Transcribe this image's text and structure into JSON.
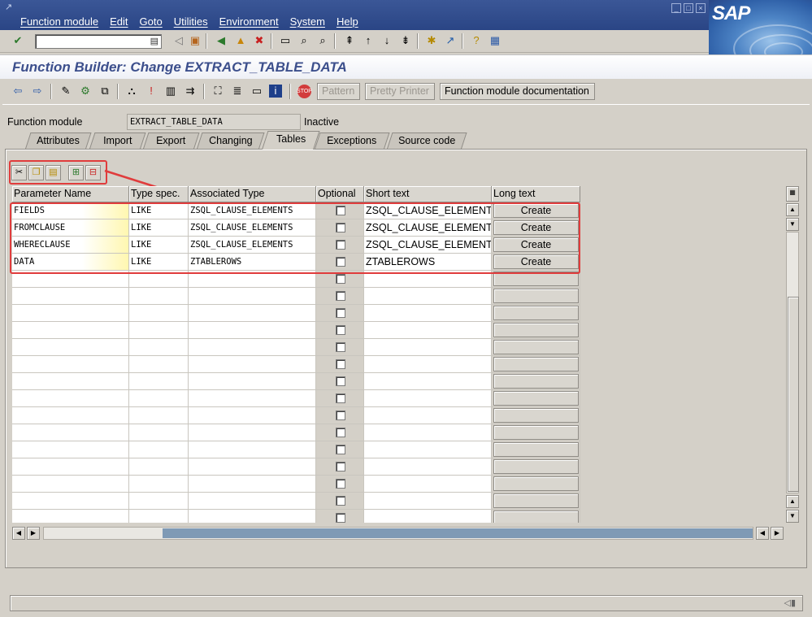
{
  "menu": [
    "Function module",
    "Edit",
    "Goto",
    "Utilities",
    "Environment",
    "System",
    "Help"
  ],
  "brand": {
    "logo_text": "SAP"
  },
  "command_field": {
    "value": ""
  },
  "title": "Function Builder: Change EXTRACT_TABLE_DATA",
  "app_toolbar": {
    "pattern_label": "Pattern",
    "pretty_printer_label": "Pretty Printer",
    "fm_doc_label": "Function module documentation"
  },
  "header_fields": {
    "function_module_label": "Function module",
    "function_module_value": "EXTRACT_TABLE_DATA",
    "status": "Inactive"
  },
  "tabs": [
    {
      "label": "Attributes",
      "active": false
    },
    {
      "label": "Import",
      "active": false
    },
    {
      "label": "Export",
      "active": false
    },
    {
      "label": "Changing",
      "active": false
    },
    {
      "label": "Tables",
      "active": true
    },
    {
      "label": "Exceptions",
      "active": false
    },
    {
      "label": "Source code",
      "active": false
    }
  ],
  "table": {
    "columns": [
      "Parameter Name",
      "Type spec.",
      "Associated Type",
      "Optional",
      "Short text",
      "Long text"
    ],
    "rows": [
      {
        "name": "FIELDS",
        "type_spec": "LIKE",
        "assoc_type": "ZSQL_CLAUSE_ELEMENTS",
        "optional": false,
        "short_text": "ZSQL_CLAUSE_ELEMENTS",
        "long_text": "Create"
      },
      {
        "name": "FROMCLAUSE",
        "type_spec": "LIKE",
        "assoc_type": "ZSQL_CLAUSE_ELEMENTS",
        "optional": false,
        "short_text": "ZSQL_CLAUSE_ELEMENTS",
        "long_text": "Create"
      },
      {
        "name": "WHERECLAUSE",
        "type_spec": "LIKE",
        "assoc_type": "ZSQL_CLAUSE_ELEMENTS",
        "optional": false,
        "short_text": "ZSQL_CLAUSE_ELEMENTS",
        "long_text": "Create"
      },
      {
        "name": "DATA",
        "type_spec": "LIKE",
        "assoc_type": "ZTABLEROWS",
        "optional": false,
        "short_text": "ZTABLEROWS",
        "long_text": "Create"
      }
    ]
  },
  "colors": {
    "menubar": "#2a4585",
    "title_text": "#3c4f8c",
    "highlight": "#e03c3c",
    "background": "#d4d0c8"
  }
}
